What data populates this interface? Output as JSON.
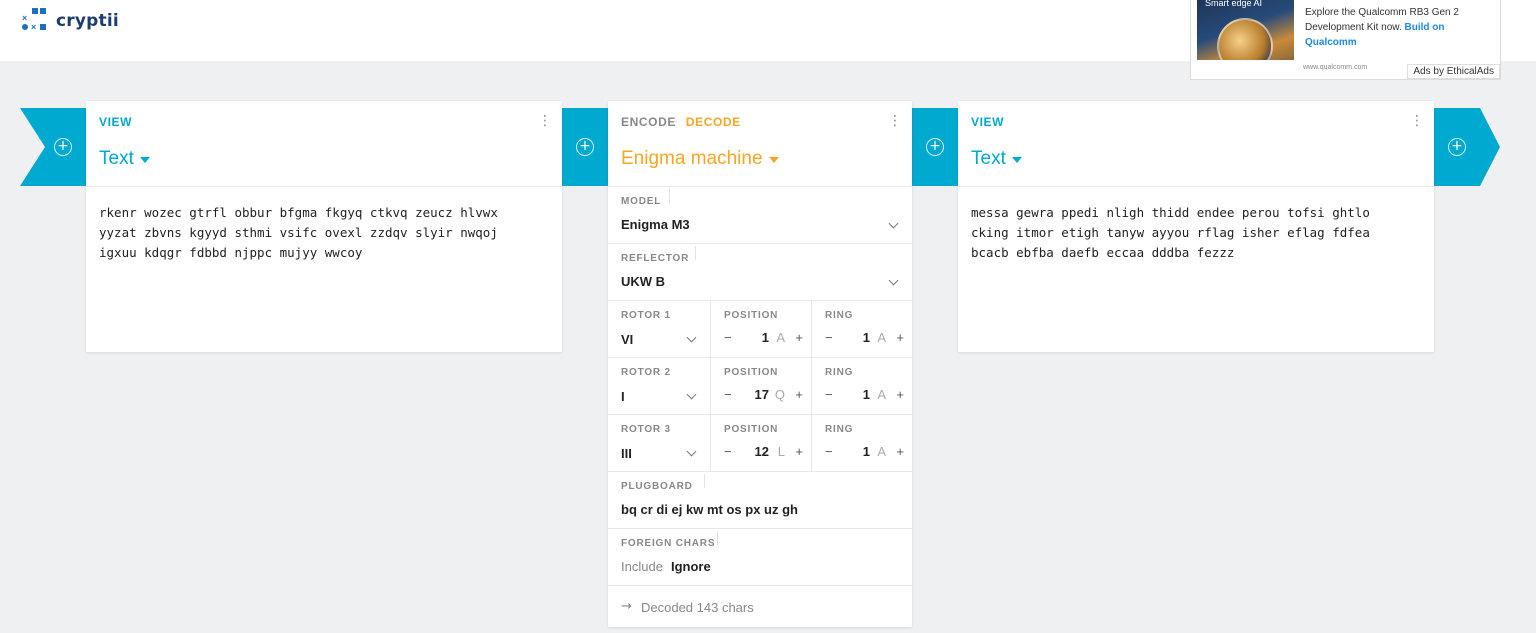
{
  "app": {
    "name": "cryptii"
  },
  "ad": {
    "image_label": "Smart edge AI",
    "body": "Explore the Qualcomm RB3 Gen 2 Development Kit now.",
    "cta": "Build on Qualcomm",
    "domain": "www.qualcomm.com",
    "by": "Ads by EthicalAds"
  },
  "left_view": {
    "category": "VIEW",
    "title": "Text",
    "content": "rkenr wozec gtrfl obbur bfgma fkgyq ctkvq zeucz hlvwx\nyyzat zbvns kgyyd sthmi vsifc ovexl zzdqv slyir nwqoj\nigxuu kdqgr fdbbd njppc mujyy wwcoy"
  },
  "encoder": {
    "encode_label": "ENCODE",
    "decode_label": "DECODE",
    "title": "Enigma machine",
    "model": {
      "label": "MODEL",
      "value": "Enigma M3"
    },
    "reflector": {
      "label": "REFLECTOR",
      "value": "UKW B"
    },
    "rotors": [
      {
        "label": "ROTOR 1",
        "value": "VI",
        "position_label": "POSITION",
        "position": "1",
        "position_letter": "A",
        "ring_label": "RING",
        "ring": "1",
        "ring_letter": "A"
      },
      {
        "label": "ROTOR 2",
        "value": "I",
        "position_label": "POSITION",
        "position": "17",
        "position_letter": "Q",
        "ring_label": "RING",
        "ring": "1",
        "ring_letter": "A"
      },
      {
        "label": "ROTOR 3",
        "value": "III",
        "position_label": "POSITION",
        "position": "12",
        "position_letter": "L",
        "ring_label": "RING",
        "ring": "1",
        "ring_letter": "A"
      }
    ],
    "plugboard": {
      "label": "PLUGBOARD",
      "value": "bq cr di ej kw mt os px uz gh"
    },
    "foreign_chars": {
      "label": "FOREIGN CHARS",
      "include": "Include",
      "ignore": "Ignore"
    },
    "status": "Decoded 143 chars"
  },
  "right_view": {
    "category": "VIEW",
    "title": "Text",
    "content": "messa gewra ppedi nligh thidd endee perou tofsi ghtlo\ncking itmor etigh tanyw ayyou rflag isher eflag fdfea\nbcacb ebfba daefb eccaa dddba fezzz"
  },
  "stepper": {
    "minus": "−",
    "plus": "+"
  },
  "colors": {
    "accent": "#00a9cf",
    "decode": "#f5a623",
    "background": "#eff0f2"
  },
  "icons": [
    "add-circle-icon",
    "more-vert-icon",
    "caret-down-icon",
    "chevron-down-icon",
    "arrow-right-icon"
  ]
}
